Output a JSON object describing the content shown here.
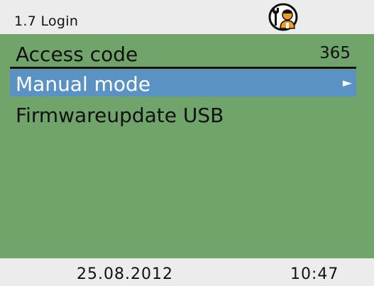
{
  "header": {
    "title": "1.7 Login",
    "user_icon": "service-technician-icon"
  },
  "menu": {
    "items": [
      {
        "label": "Access code",
        "value": "365"
      },
      {
        "label": "Manual mode",
        "indicator": "►",
        "selected": true
      },
      {
        "label": "Firmwareupdate USB"
      }
    ]
  },
  "footer": {
    "date": "25.08.2012",
    "time": "10:47"
  },
  "colors": {
    "header_bg": "#ececec",
    "main_bg": "#71a46b",
    "highlight": "#5b92c4",
    "icon_orange": "#f39a1e"
  }
}
